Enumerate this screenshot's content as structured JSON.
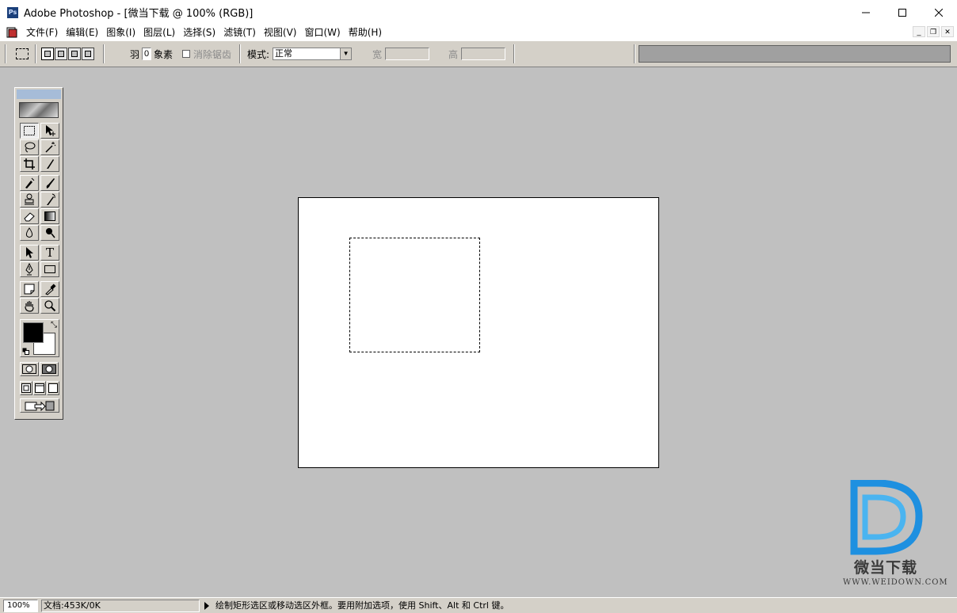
{
  "window": {
    "title": "Adobe Photoshop - [微当下载 @ 100% (RGB)]",
    "app_icon_text": "Ps"
  },
  "menu": {
    "items": [
      "文件(F)",
      "编辑(E)",
      "图象(I)",
      "图层(L)",
      "选择(S)",
      "滤镜(T)",
      "视图(V)",
      "窗口(W)",
      "帮助(H)"
    ]
  },
  "options": {
    "feather_label": "羽",
    "feather_value": "0",
    "feather_unit": "象素",
    "antialias_label": "消除锯齿",
    "style_label": "模式:",
    "style_value": "正常",
    "width_label": "宽",
    "height_label": "高"
  },
  "toolbox": {
    "type_tool_glyph": "T"
  },
  "watermark": {
    "name": "微当下载",
    "url": "WWW.WEIDOWN.COM",
    "accent_color": "#1e90e0"
  },
  "status": {
    "zoom": "100%",
    "doc_info": "文档:453K/0K",
    "hint": "绘制矩形选区或移动选区外框。要用附加选项，使用 Shift、Alt 和 Ctrl 键。"
  }
}
